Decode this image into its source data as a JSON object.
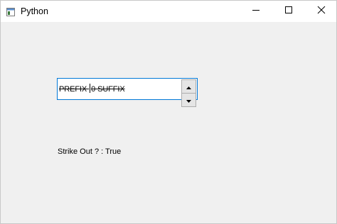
{
  "window": {
    "title": "Python",
    "icon": "app-window-icon",
    "controls": [
      "minimize-icon",
      "maximize-icon",
      "close-icon"
    ]
  },
  "spinbox": {
    "prefix": "PREFIX",
    "value": "0",
    "suffix": "SUFFIX",
    "up_icon": "arrow-up-icon",
    "down_icon": "arrow-down-icon",
    "focus_color": "#0078d7"
  },
  "status": {
    "label": "Strike Out ? : True"
  }
}
